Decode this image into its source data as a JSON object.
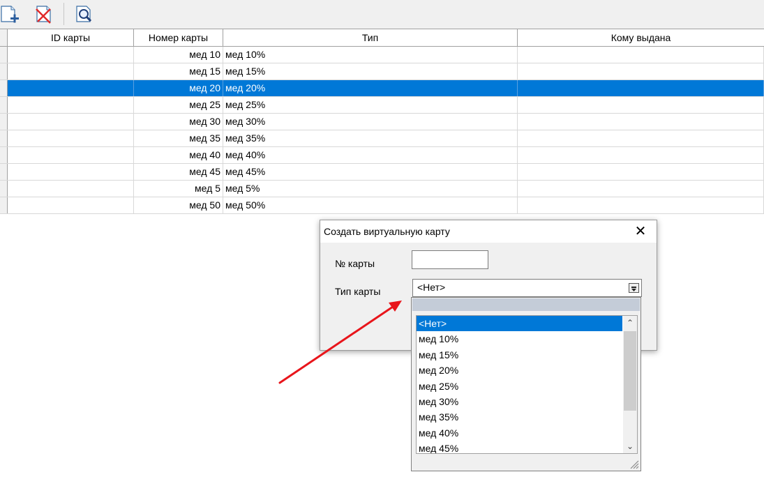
{
  "toolbar": {
    "buttons": [
      {
        "icon": "add-document-icon"
      },
      {
        "icon": "delete-document-icon"
      },
      {
        "icon": "search-magnifier-icon"
      }
    ]
  },
  "grid": {
    "columns": [
      "ID карты",
      "Номер карты",
      "Тип",
      "Кому выдана"
    ],
    "rows": [
      {
        "id": "",
        "number": "мед 10",
        "type": "мед 10%",
        "issued_to": ""
      },
      {
        "id": "",
        "number": "мед 15",
        "type": "мед 15%",
        "issued_to": ""
      },
      {
        "id": "",
        "number": "мед 20",
        "type": "мед 20%",
        "issued_to": "",
        "selected": true
      },
      {
        "id": "",
        "number": "мед 25",
        "type": "мед 25%",
        "issued_to": ""
      },
      {
        "id": "",
        "number": "мед 30",
        "type": "мед 30%",
        "issued_to": ""
      },
      {
        "id": "",
        "number": "мед 35",
        "type": "мед 35%",
        "issued_to": ""
      },
      {
        "id": "",
        "number": "мед 40",
        "type": "мед 40%",
        "issued_to": ""
      },
      {
        "id": "",
        "number": "мед 45",
        "type": "мед 45%",
        "issued_to": ""
      },
      {
        "id": "",
        "number": "мед 5",
        "type": "мед 5%",
        "issued_to": ""
      },
      {
        "id": "",
        "number": "мед 50",
        "type": "мед 50%",
        "issued_to": ""
      }
    ],
    "selection_color": "#0078d7"
  },
  "dialog": {
    "title": "Создать виртуальную карту",
    "close_glyph": "✕",
    "card_number_label": "№ карты",
    "card_number_value": "",
    "card_type_label": "Тип карты",
    "card_type_value": "<Нет>"
  },
  "dropdown": {
    "items": [
      "<Нет>",
      "мед 10%",
      "мед 15%",
      "мед 20%",
      "мед 25%",
      "мед 30%",
      "мед 35%",
      "мед 40%",
      "мед 45%"
    ],
    "selected_index": 0,
    "scroll_up_glyph": "⌃",
    "scroll_down_glyph": "⌄"
  },
  "annotation": {
    "arrow_color": "#e8151b"
  }
}
